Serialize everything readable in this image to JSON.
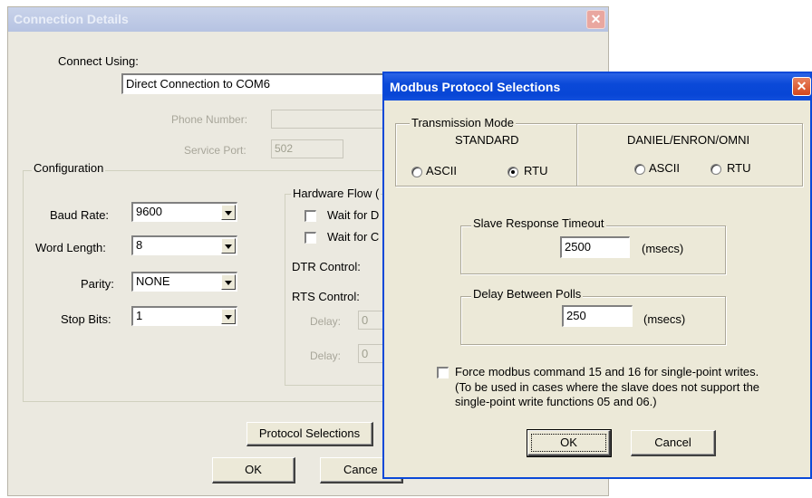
{
  "connection_dialog": {
    "title": "Connection Details",
    "connect_using_label": "Connect Using:",
    "connect_using_value": "Direct Connection to COM6",
    "phone_number_label": "Phone Number:",
    "phone_number_value": "",
    "service_port_label": "Service Port:",
    "service_port_value": "502",
    "configuration_label": "Configuration",
    "baud_rate_label": "Baud Rate:",
    "baud_rate_value": "9600",
    "word_length_label": "Word Length:",
    "word_length_value": "8",
    "parity_label": "Parity:",
    "parity_value": "NONE",
    "stop_bits_label": "Stop Bits:",
    "stop_bits_value": "1",
    "hw_flow_label": "Hardware Flow (",
    "wait_d_label": "Wait for D",
    "wait_c_label": "Wait for C",
    "dtr_label": "DTR Control:",
    "rts_label": "RTS Control:",
    "delay1_label": "Delay:",
    "delay1_value": "0",
    "delay2_label": "Delay:",
    "delay2_value": "0",
    "protocol_button": "Protocol Selections",
    "ok_button": "OK",
    "cancel_button": "Cance"
  },
  "modbus_dialog": {
    "title": "Modbus Protocol Selections",
    "transmission_mode_label": "Transmission Mode",
    "standard_label": "STANDARD",
    "daniel_label": "DANIEL/ENRON/OMNI",
    "ascii_label": "ASCII",
    "rtu_label": "RTU",
    "standard_selected": "RTU",
    "daniel_selected": "none",
    "slave_timeout_label": "Slave Response Timeout",
    "slave_timeout_value": "2500",
    "slave_timeout_unit": "(msecs)",
    "delay_polls_label": "Delay Between Polls",
    "delay_polls_value": "250",
    "delay_polls_unit": "(msecs)",
    "force_line1": "Force modbus command 15 and 16 for single-point writes.",
    "force_line2": "(To be used in cases where the slave does not support the",
    "force_line3": "single-point write functions 05 and 06.)",
    "ok_button": "OK",
    "cancel_button": "Cancel"
  },
  "icons": {
    "close": "close-icon",
    "dropdown": "chevron-down-icon"
  },
  "colors": {
    "titlebar_active": "#0a49d8",
    "titlebar_inactive": "#b6c3e2",
    "dialog_bg": "#ece9d8"
  }
}
